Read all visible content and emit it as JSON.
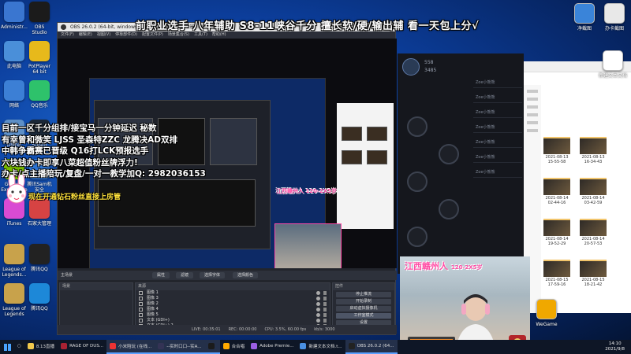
{
  "desktop_icons_left": [
    {
      "label": "Administr...",
      "color": "#3a76d0",
      "glyph": "folder-user-icon"
    },
    {
      "label": "OBS Studio",
      "color": "#1b1b1b",
      "glyph": "obs-icon"
    },
    {
      "label": "此电脑",
      "color": "#4a8fd9",
      "glyph": "computer-icon"
    },
    {
      "label": "PotPlayer 64 bit",
      "color": "#e7b91b",
      "glyph": "potplayer-icon"
    },
    {
      "label": "网络",
      "color": "#3c7fd5",
      "glyph": "network-icon"
    },
    {
      "label": "QQ音乐",
      "color": "#2ec26b",
      "glyph": "qqmusic-icon"
    },
    {
      "label": "回收站",
      "color": "#5d8fc7",
      "glyph": "recycle-icon"
    },
    {
      "label": "Steam",
      "color": "#1b2838",
      "glyph": "steam-icon"
    },
    {
      "label": "GeForce Experience",
      "color": "#76b900",
      "glyph": "geforce-icon"
    },
    {
      "label": "腾讯Sam机 安全",
      "color": "#2d73d1",
      "glyph": "security-icon"
    },
    {
      "label": "iTunes",
      "color": "#d94bd3",
      "glyph": "itunes-icon"
    },
    {
      "label": "石家大管理",
      "color": "#d64343",
      "glyph": "manager-icon"
    },
    {
      "label": "League of Legends...",
      "color": "#c8a24b",
      "glyph": "lol-icon"
    },
    {
      "label": "腾讯QQ",
      "color": "#222",
      "glyph": "qq-icon"
    },
    {
      "label": "League of Legends",
      "color": "#c8a24b",
      "glyph": "lol-icon"
    },
    {
      "label": "腾讯QQ",
      "color": "#1d88d8",
      "glyph": "qq-icon"
    }
  ],
  "top_banner": "前职业选手 八年辅助 S8-11峡谷千分 擅长软/硬/输出辅 看一天包上分√",
  "overlay_lines": [
    "目前一区千分组排/接宝马一分钟延迟 秘数",
    "有幸曾和微笑 LJSS 圣森特ZZC 龙腾决AD双排",
    "中韩争霸赛已晋级 Q16打LCK预报选手",
    "六块钱办卡即享八菜超值粉丝牌浮力!",
    "办卡/点主播陪玩/复盘/一对一教学加Q: 2982036153"
  ],
  "yellow_line": "现在开通钻石粉丝直接上房管",
  "webcam_title": "江西赣州人",
  "webcam_subtitle": "120-2X5岁",
  "obs": {
    "title": "OBS 26.0.2 (64-bit, windows) - 配置文件: 未命名 - 场景: 未命名",
    "menu": [
      "文件(F)",
      "编辑(E)",
      "视图(V)",
      "停靠部件(D)",
      "配置文件(P)",
      "场景集合(S)",
      "工具(T)",
      "帮助(H)"
    ],
    "scene_label": "主场景",
    "tabs": [
      "属性",
      "滤镜",
      "选择字体",
      "选择颜色"
    ],
    "scenes_header": "场景",
    "sources_header": "来源",
    "sources": [
      "图像 1",
      "图像 3",
      "图像 2",
      "图像 4",
      "图像 5",
      "文本 (GDI+)",
      "文本 (GDI+) 2",
      "文本 (GDI+) 4"
    ],
    "controls_header": "控件",
    "controls": [
      "停止推流",
      "开始录制",
      "启动虚拟摄像机",
      "工作室模式",
      "设置",
      "退出"
    ],
    "mixer_tabs": [
      "控件",
      "场景转换"
    ],
    "status": [
      "LIVE: 00:35:01",
      "REC: 00:00:00",
      "CPU: 3.5%, 60.00 fps",
      "kb/s: 3000"
    ]
  },
  "dark_app": {
    "user": "Zoe小熊熊",
    "count1": "558",
    "count2": "3485",
    "items": [
      "Zoe小熊熊",
      "Zoe小熊熊",
      "Zoe小熊熊",
      "Zoe小熊熊",
      "Zoe小熊熊",
      "Zoe小熊熊",
      "Zoe小熊熊"
    ]
  },
  "explorer_files": [
    {
      "name": "2021-08-13\n15-55-58"
    },
    {
      "name": "2021-08-13\n16-34-43"
    },
    {
      "name": "2021-08-14\n02-44-16"
    },
    {
      "name": "2021-08-14\n03-42-59"
    },
    {
      "name": "2021-08-14\n19-52-29"
    },
    {
      "name": "2021-08-14\n20-57-53"
    },
    {
      "name": "2021-08-15\n17-59-16"
    },
    {
      "name": "2021-08-15\n18-21-42"
    }
  ],
  "right_icons": [
    {
      "label": "净截图",
      "color": "#3a84d9",
      "glyph": "screenshot-icon"
    },
    {
      "label": "办卡截图",
      "color": "#e8e8e8",
      "glyph": "card-icon"
    },
    {
      "label": "新建文本文档",
      "color": "#ffffff",
      "glyph": "text-doc-icon"
    },
    {
      "label": "WeGame",
      "color": "#f0a800",
      "glyph": "wegame-icon"
    }
  ],
  "taskbar": {
    "items": [
      {
        "label": "8.13直播",
        "color": "#f2c94c",
        "active": false
      },
      {
        "label": "RAGE OF DUS...",
        "color": "#a23",
        "active": false
      },
      {
        "label": "小米陪玩 (在线...",
        "color": "#e33",
        "active": true
      },
      {
        "label": "--实时口口--实A...",
        "color": "#335",
        "active": true
      },
      {
        "label": "",
        "color": "#1b1b1b",
        "active": true
      },
      {
        "label": "合合唱",
        "color": "#fa0",
        "active": false
      },
      {
        "label": "Adobe Premie...",
        "color": "#9b5fe3",
        "active": false
      },
      {
        "label": "新建文本文档.t...",
        "color": "#4a90e2",
        "active": false
      },
      {
        "label": "OBS 26.0.2 (64...",
        "color": "#222",
        "active": true
      }
    ],
    "time": "14:10",
    "date": "2021/9/8"
  }
}
